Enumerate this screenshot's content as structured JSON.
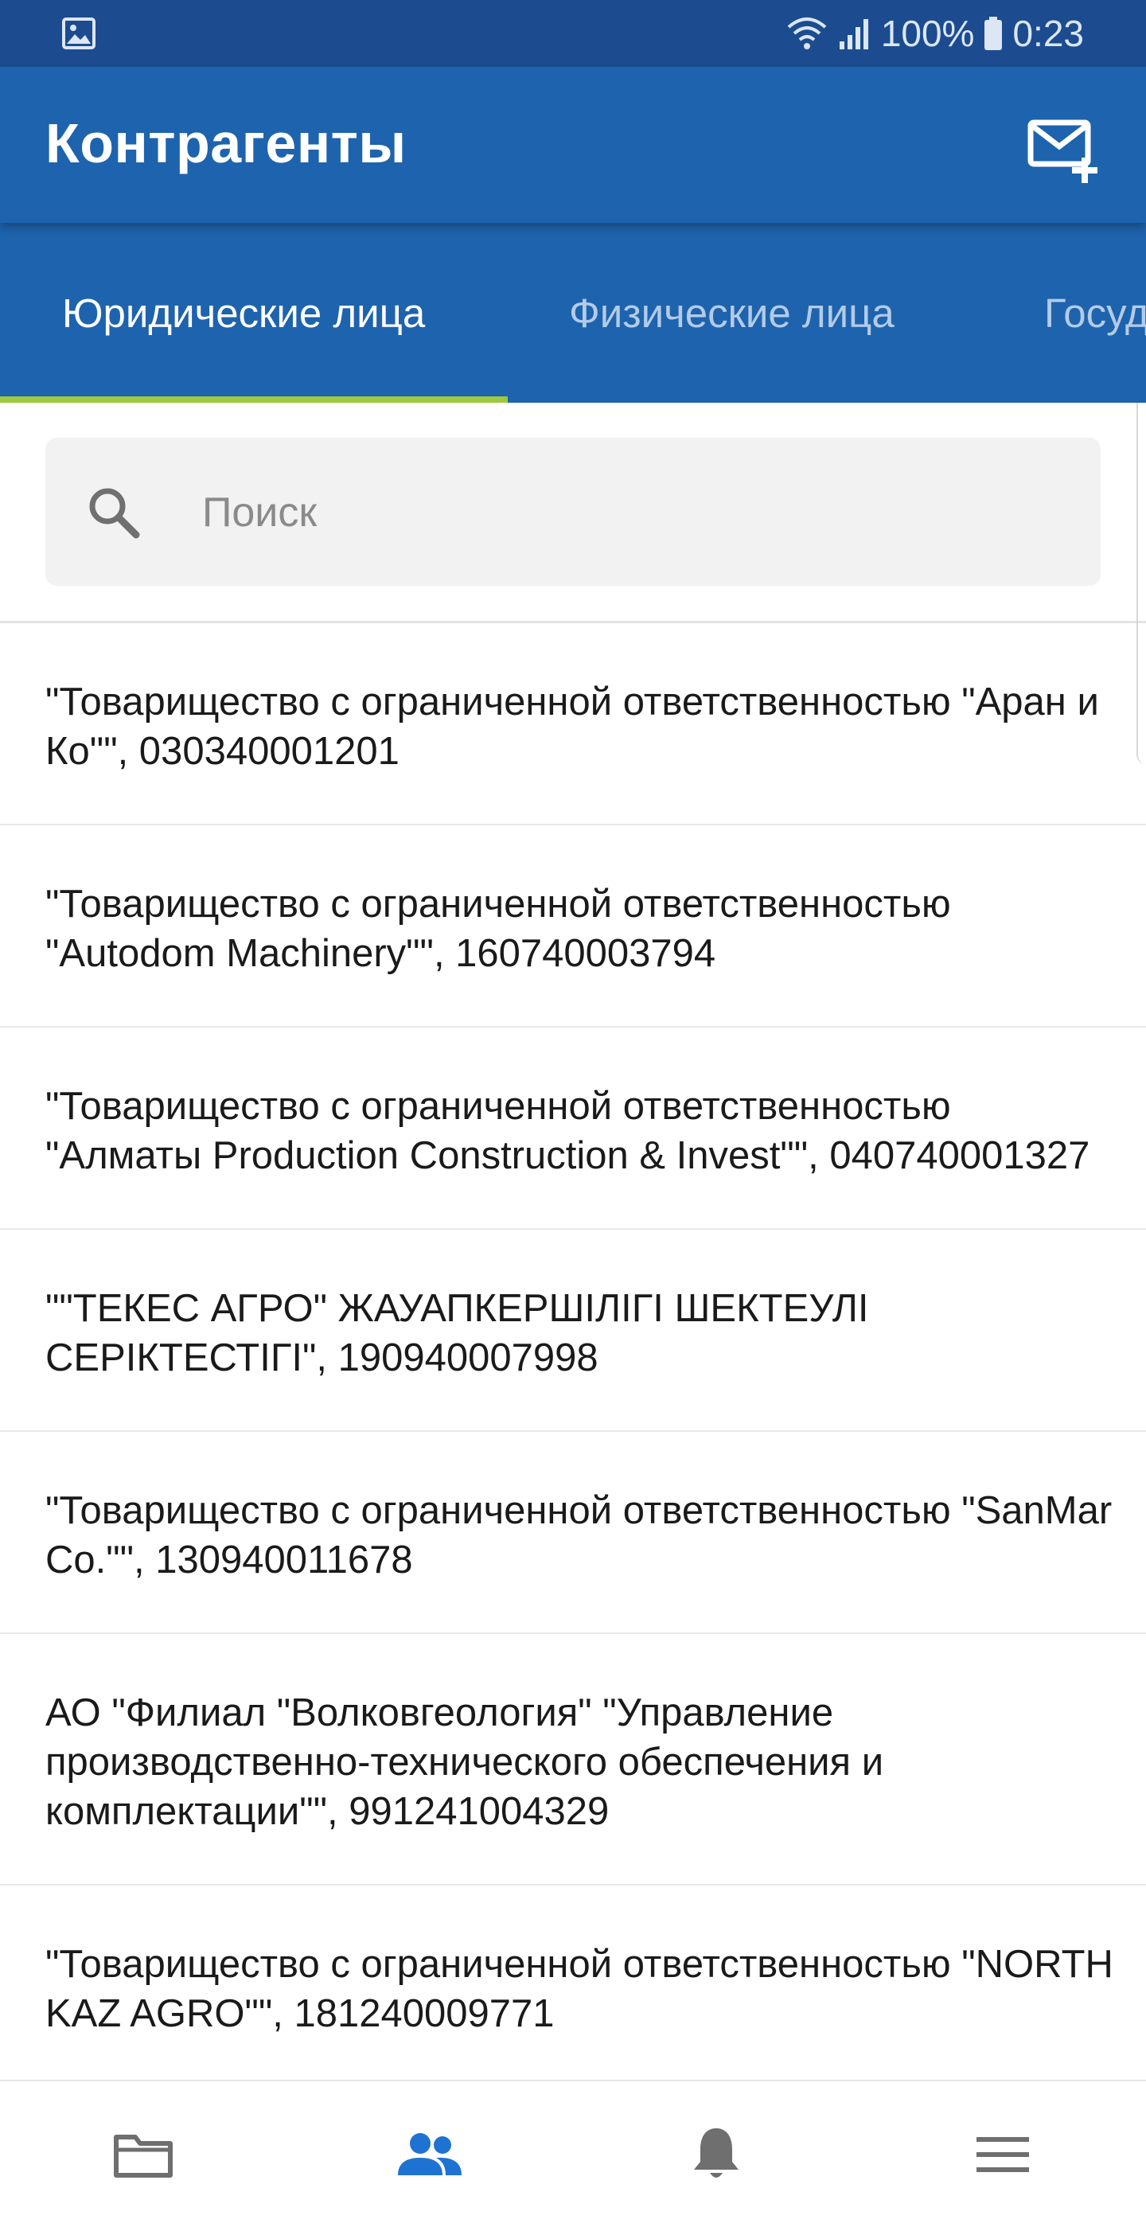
{
  "status_bar": {
    "battery": "100%",
    "time": "0:23",
    "icons": [
      "image-icon",
      "wifi-icon",
      "signal-icon",
      "battery-icon"
    ]
  },
  "app_bar": {
    "title": "Контрагенты",
    "action_icon": "mail-add-icon"
  },
  "tabs": [
    {
      "label": "Юридические лица",
      "active": true
    },
    {
      "label": "Физические лица",
      "active": false
    },
    {
      "label": "Государственные органы",
      "active": false
    }
  ],
  "search": {
    "placeholder": "Поиск",
    "value": ""
  },
  "list": [
    {
      "text": " \"Товарищество с ограниченной ответственностью \"Аран и Ко\"\", 030340001201"
    },
    {
      "text": " \"Товарищество с ограниченной ответственностью \"Autodom Machinery\"\", 160740003794"
    },
    {
      "text": " \"Товарищество с ограниченной ответственностью \"Алматы Production Construction & Invest\"\", 040740001327"
    },
    {
      "text": " \"\"ТЕКЕС АГРО\" ЖАУАПКЕРШІЛІГІ ШЕКТЕУЛІ СЕРІКТЕСТІГІ\", 190940007998"
    },
    {
      "text": " \"Товарищество с ограниченной ответственностью \"SanMar Co.\"\", 130940011678"
    },
    {
      "text": "АО \"Филиал \"Волковгеология\" \"Управление производственно-технического обеспечения и комплектации\"\", 991241004329"
    },
    {
      "text": " \"Товарищество с ограниченной ответственностью \"NORTH KAZ AGRO\"\", 181240009771"
    }
  ],
  "bottom_nav": [
    {
      "icon": "folder-icon",
      "active": false
    },
    {
      "icon": "contacts-icon",
      "active": true
    },
    {
      "icon": "bell-icon",
      "active": false
    },
    {
      "icon": "menu-icon",
      "active": false
    }
  ],
  "colors": {
    "status_bar": "#1c4c8f",
    "app_bar": "#1e63ad",
    "tab_indicator": "#9ec93d",
    "nav_active": "#1e73d2",
    "nav_inactive": "#6f6f6f"
  }
}
